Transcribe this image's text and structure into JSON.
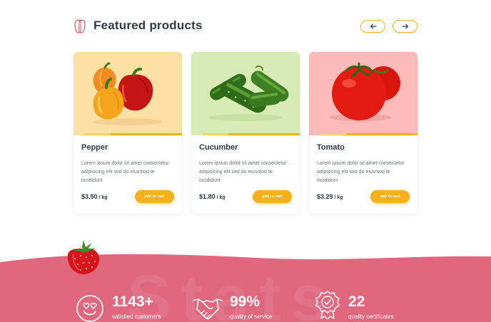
{
  "section": {
    "title": "Featured products",
    "icon": "pepper-outline-icon",
    "prev_icon": "arrow-left-icon",
    "next_icon": "arrow-right-icon",
    "accent_color": "#f5b01c"
  },
  "products": [
    {
      "name": "Pepper",
      "description": "Lorem ipsum dolor sit amet consectetur adipisicing elit sed do eiusmod te incididunt",
      "price": "$3.50",
      "unit": "/ kg",
      "button_label": "add to cart",
      "image_bg": "#fde0a3"
    },
    {
      "name": "Cucumber",
      "description": "Lorem ipsum dolor sit amet consectetur adipisicing elit sed do eiusmod te incididunt",
      "price": "$1.80",
      "unit": "/ kg",
      "button_label": "add to cart",
      "image_bg": "#d6ecb4"
    },
    {
      "name": "Tomato",
      "description": "Lorem ipsum dolor sit amet consectetur adipisicing elit sed do eiusmod te incididunt",
      "price": "$3.29",
      "unit": "/ kg",
      "button_label": "add to cart",
      "image_bg": "#fdbbb8"
    }
  ],
  "stats": {
    "background_color": "#e0687e",
    "items": [
      {
        "value": "1143+",
        "label": "satisfied customers",
        "icon": "smiley-hearts-icon"
      },
      {
        "value": "99%",
        "label": "quality of service",
        "icon": "handshake-icon"
      },
      {
        "value": "22",
        "label": "quality certificates",
        "icon": "badge-check-icon"
      }
    ]
  }
}
